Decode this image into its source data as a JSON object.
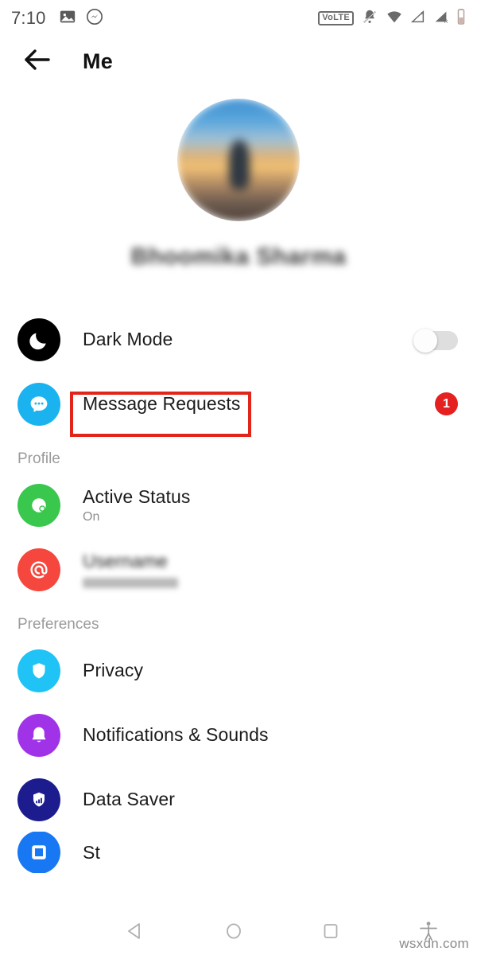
{
  "status_bar": {
    "time": "7:10",
    "left_icons": [
      "gallery-icon",
      "messenger-icon"
    ],
    "right_icons": [
      "volte-icon",
      "bell-muted-icon",
      "wifi-icon",
      "signal-sim1-icon",
      "signal-sim2-icon",
      "battery-icon"
    ],
    "volte_label": "VoLTE"
  },
  "header": {
    "back_icon": "back-arrow-icon",
    "title": "Me"
  },
  "profile": {
    "avatar_alt": "profile-photo-sunset-blurred",
    "name": "Bhoomika Sharma",
    "name_blurred": true
  },
  "list": {
    "rows": [
      {
        "id": "dark-mode",
        "label": "Dark Mode",
        "icon": "moon-icon",
        "icon_color": "#000000",
        "control": "toggle",
        "toggle_on": false
      },
      {
        "id": "message-requests",
        "label": "Message Requests",
        "icon": "chat-bubble-icon",
        "icon_color": "#1ab3f0",
        "control": "badge",
        "badge": "1",
        "badge_color": "#e52020",
        "highlighted": true
      }
    ],
    "sections": [
      {
        "title": "Profile",
        "rows": [
          {
            "id": "active-status",
            "label": "Active Status",
            "sublabel": "On",
            "icon": "active-status-icon",
            "icon_color": "#3ac74e"
          },
          {
            "id": "username",
            "label": "Username",
            "sublabel": "",
            "icon": "at-sign-icon",
            "icon_color": "#f5473d",
            "blurred": true
          }
        ]
      },
      {
        "title": "Preferences",
        "rows": [
          {
            "id": "privacy",
            "label": "Privacy",
            "icon": "shield-icon",
            "icon_color": "#1fc3f5"
          },
          {
            "id": "notifications-sounds",
            "label": "Notifications & Sounds",
            "icon": "bell-icon",
            "icon_color": "#a033e8"
          },
          {
            "id": "data-saver",
            "label": "Data Saver",
            "icon": "shield-bars-icon",
            "icon_color": "#1c1c8f"
          },
          {
            "id": "stories",
            "label": "St",
            "icon": "story-icon",
            "icon_color": "#1877f2",
            "cut_off": true
          }
        ]
      }
    ]
  },
  "annotation": {
    "type": "rectangle-highlight",
    "color": "#e1251b",
    "target": "Message Requests"
  },
  "nav_bar": {
    "buttons": [
      "back-triangle-icon",
      "home-circle-icon",
      "recents-square-icon",
      "accessibility-icon"
    ]
  },
  "watermark": {
    "text": "wsxdn.com"
  }
}
